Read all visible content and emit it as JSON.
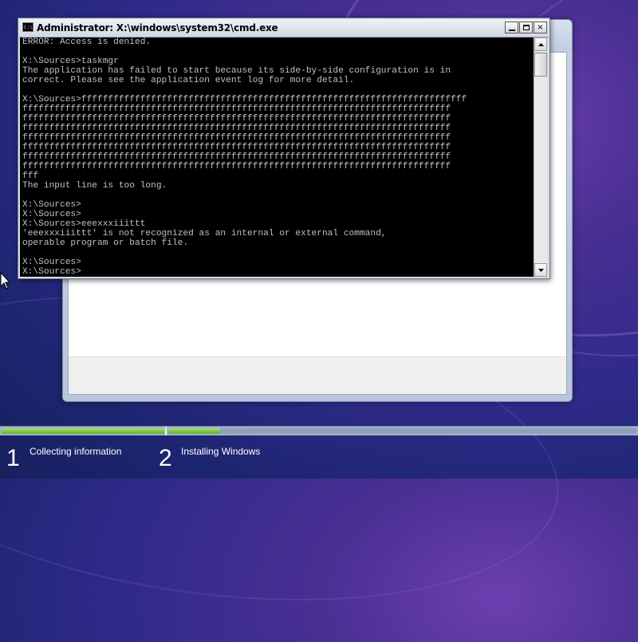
{
  "cmd_window": {
    "title": "Administrator: X:\\windows\\system32\\cmd.exe",
    "icon": "cmd-icon",
    "icon_text": "C:\\.",
    "caption_buttons": {
      "minimize": "minimize-icon",
      "maximize": "maximize-icon",
      "close": "×"
    },
    "console_lines": [
      "ERROR: Access is denied.",
      "",
      "X:\\Sources>taskmgr",
      "The application has failed to start because its side-by-side configuration is in",
      "correct. Please see the application event log for more detail.",
      "",
      "X:\\Sources>ffffffffffffffffffffffffffffffffffffffffffffffffffffffffffffffffffffffff",
      "ffffffffffffffffffffffffffffffffffffffffffffffffffffffffffffffffffffffffffffffff",
      "ffffffffffffffffffffffffffffffffffffffffffffffffffffffffffffffffffffffffffffffff",
      "ffffffffffffffffffffffffffffffffffffffffffffffffffffffffffffffffffffffffffffffff",
      "ffffffffffffffffffffffffffffffffffffffffffffffffffffffffffffffffffffffffffffffff",
      "ffffffffffffffffffffffffffffffffffffffffffffffffffffffffffffffffffffffffffffffff",
      "ffffffffffffffffffffffffffffffffffffffffffffffffffffffffffffffffffffffffffffffff",
      "ffffffffffffffffffffffffffffffffffffffffffffffffffffffffffffffffffffffffffffffff",
      "fff",
      "The input line is too long.",
      "",
      "X:\\Sources>",
      "X:\\Sources>",
      "X:\\Sources>eeexxxiiittt",
      "'eeexxxiiittt' is not recognized as an internal or external command,",
      "operable program or batch file.",
      "",
      "X:\\Sources>",
      "X:\\Sources>",
      "X:\\Sources>"
    ]
  },
  "setup_progress": {
    "steps": [
      {
        "number": "1",
        "label": "Collecting information",
        "progress": 1.0
      },
      {
        "number": "2",
        "label": "Installing Windows",
        "progress": 0.11
      }
    ],
    "fill_color": "#6cbf3a"
  }
}
